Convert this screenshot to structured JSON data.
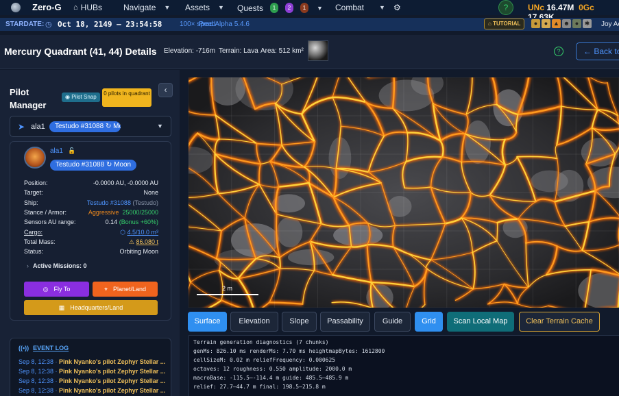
{
  "nav": {
    "brand": "Zero-G",
    "hubs": "HUBs",
    "navigate": "Navigate",
    "assets": "Assets",
    "quests": "Quests",
    "quest_badges": [
      {
        "label": "1",
        "color": "#2e9e4f"
      },
      {
        "label": "2",
        "color": "#8e3fd6"
      },
      {
        "label": "1",
        "color": "#8a3a1e"
      }
    ],
    "combat": "Combat",
    "unc_label": "UNc",
    "unc_value": "16.47M",
    "ogc_label": "0Gc",
    "ogc_value": "17.63K"
  },
  "stardate": {
    "label": "STARDATE:",
    "date": "Oct 18, 2149 — 23:54:58",
    "speed": "100× speed",
    "prod": "Prod Alpha 5.4.6",
    "tutorial": "TUTORIAL",
    "user": "Joy Ac"
  },
  "header": {
    "title": "Mercury Quadrant (41, 44) Details",
    "elevation": "Elevation: -716m",
    "terrain": "Terrain: Lava",
    "area": "Area: 512 km²",
    "back": "Back to"
  },
  "pilot_manager": {
    "title": "Pilot Manager",
    "snap": "Pilot Snap",
    "pilots_in": "0 pilots in quadrant",
    "selected_pilot": "ala1",
    "selected_ship": "Testudo #31088 ↻ Mc"
  },
  "pilot_card": {
    "name": "ala1",
    "ship_pill": "Testudo #31088 ↻ Moon",
    "rows": [
      {
        "k": "Position:",
        "v": "-0.0000 AU, -0.0000 AU"
      },
      {
        "k": "Target:",
        "v": "None"
      },
      {
        "k": "Ship:",
        "v": "Testudo #31088",
        "v2": "(Testudo)"
      },
      {
        "k": "Stance / Armor:",
        "v": "Aggressive",
        "v2": "25000/25000"
      },
      {
        "k": "Sensors AU range:",
        "v": "0.14",
        "v2": "(Bonus +60%)"
      },
      {
        "k": "Cargo:",
        "v": "4.5/10.0 m³"
      },
      {
        "k": "Total Mass:",
        "v": "86.080 t"
      },
      {
        "k": "Status:",
        "v": "Orbiting Moon"
      }
    ],
    "missions": "Active Missions: 0",
    "fly_to": "Fly To",
    "planet_land": "Planet/Land",
    "hq_land": "Headquarters/Land"
  },
  "event_log": {
    "title": "EVENT LOG",
    "entries": [
      {
        "time": "Sep 8, 12:38 · ",
        "text": "Pink Nyanko's pilot Zephyr Stellar ..."
      },
      {
        "time": "Sep 8, 12:38 · ",
        "text": "Pink Nyanko's pilot Zephyr Stellar ..."
      },
      {
        "time": "Sep 8, 12:38 · ",
        "text": "Pink Nyanko's pilot Zephyr Stellar ..."
      },
      {
        "time": "Sep 8, 12:38 · ",
        "text": "Pink Nyanko's pilot Zephyr Stellar ..."
      }
    ]
  },
  "map": {
    "scale_label": "2 m"
  },
  "tabs": [
    "Surface",
    "Elevation",
    "Slope",
    "Passability",
    "Guide",
    "Grid",
    "Scan Local Map",
    "Clear Terrain Cache"
  ],
  "diagnostics": [
    "Terrain generation diagnostics (7 chunks)",
    "genMs: 826.10 ms    renderMs: 7.70 ms    heightmapBytes: 1612800",
    "cellSizeM: 0.02 m    reliefFrequency: 0.000625",
    "octaves: 12    roughness: 0.550    amplitude: 2000.0 m",
    "macroBase: -115.5–-114.4 m    guide: 485.5–485.9 m",
    "relief: 27.7–44.7 m    final: 198.5–215.8 m"
  ],
  "colors": {
    "accent": "#2f8ff0",
    "lava": "#ff8a1a",
    "warning": "#f0b51e"
  }
}
